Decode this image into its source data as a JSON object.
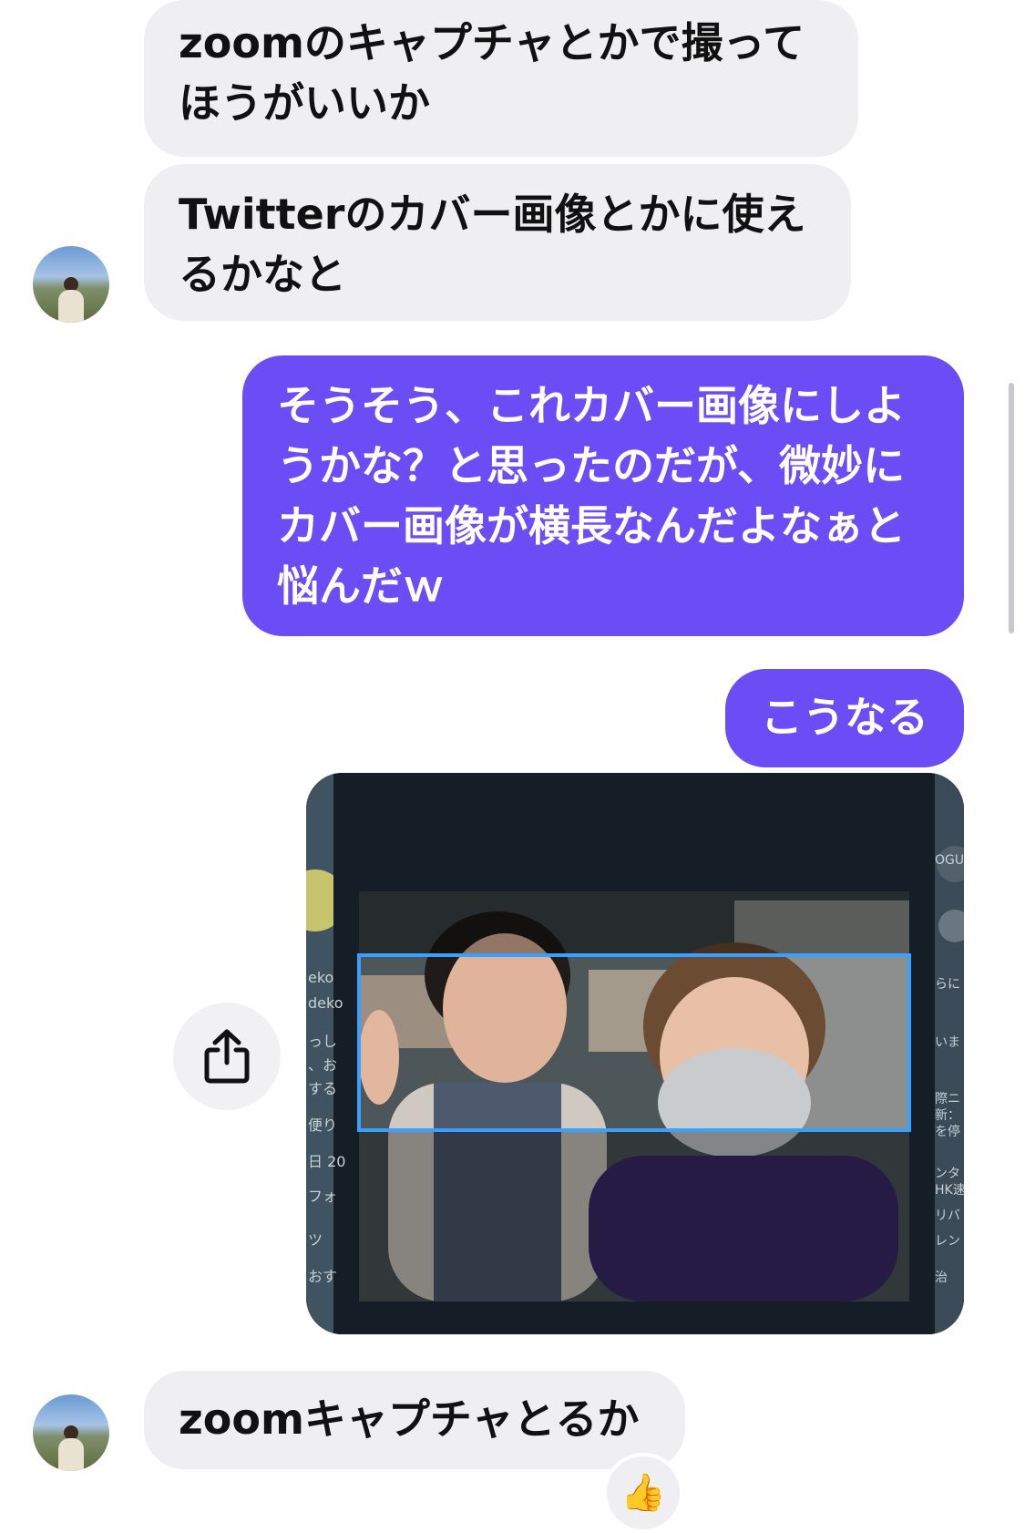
{
  "messages": {
    "in1": "zoomのキャプチャとかで撮って\nほうがいいか",
    "in2": "Twitterのカバー画像とかに使え\nるかなと",
    "out1": "そうそう、これカバー画像にしよ\nうかな？と思ったのだが、微妙に\nカバー画像が横長なんだよなぁと\n悩んだｗ",
    "out2": "こうなる",
    "in3": "zoomキャプチャとるか"
  },
  "reaction": {
    "emoji": "👍"
  },
  "image": {
    "left_panel_text": [
      "eko",
      "deko",
      "っし",
      "、お",
      "する",
      "便り",
      "日 20",
      "フォ",
      "ツ",
      "おす"
    ],
    "right_panel_text": [
      "OGUE",
      "らに",
      "いま",
      "際ニ",
      "新：",
      "を停",
      "ンタ",
      "HK速",
      "リバ",
      "レン",
      "治"
    ]
  },
  "colors": {
    "outgoing_bubble": "#6a4df5",
    "incoming_bubble": "#efeff1",
    "crop_frame": "#3aa0ff"
  },
  "icons": {
    "share": "share-icon",
    "avatar": "avatar"
  }
}
